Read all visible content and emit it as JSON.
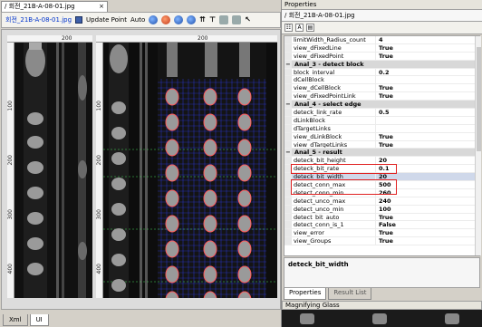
{
  "document": {
    "tab_title": "/ 회전_21B-A-08-01.jpg",
    "close_glyph": "×",
    "file_label": "회전_21B-A-08-01.jpg",
    "update_point": "Update Point",
    "auto": "Auto",
    "ruler_left_panel_top": "200",
    "ruler_right_panel_top": "200",
    "left_ruler_marks": [
      "100",
      "200",
      "300",
      "400"
    ],
    "right_ruler_marks": [
      "100",
      "200",
      "300",
      "400"
    ],
    "bottom_tabs": [
      "Xml",
      "UI"
    ]
  },
  "properties": {
    "title": "Properties",
    "subtitle": "/ 회전_21B-A-08-01.jpg",
    "rows": [
      {
        "name": "limitWidth_Radius_count",
        "value": "4",
        "type": "prop"
      },
      {
        "name": "view_dFixedLine",
        "value": "True",
        "type": "prop"
      },
      {
        "name": "view_dFixedPoint",
        "value": "True",
        "type": "prop"
      },
      {
        "name": "Anal_3 - detect block",
        "value": "",
        "type": "cat"
      },
      {
        "name": "block_interval",
        "value": "0.2",
        "type": "prop"
      },
      {
        "name": "dCellBlock",
        "value": "",
        "type": "prop"
      },
      {
        "name": "view_dCellBlock",
        "value": "True",
        "type": "prop"
      },
      {
        "name": "view_dFixedPointLink",
        "value": "True",
        "type": "prop"
      },
      {
        "name": "Anal_4 - select edge",
        "value": "",
        "type": "cat"
      },
      {
        "name": "deteck_link_rate",
        "value": "0.5",
        "type": "prop"
      },
      {
        "name": "dLinkBlock",
        "value": "",
        "type": "prop"
      },
      {
        "name": "dTargetLinks",
        "value": "",
        "type": "prop"
      },
      {
        "name": "view_dLinkBlock",
        "value": "True",
        "type": "prop"
      },
      {
        "name": "view_dTargetLinks",
        "value": "True",
        "type": "prop"
      },
      {
        "name": "Anal_5 - result",
        "value": "",
        "type": "cat"
      },
      {
        "name": "deteck_bit_height",
        "value": "20",
        "type": "prop"
      },
      {
        "name": "deteck_bit_rate",
        "value": "0.1",
        "type": "prop"
      },
      {
        "name": "deteck_bit_width",
        "value": "20",
        "type": "sel"
      },
      {
        "name": "detect_conn_max",
        "value": "500",
        "type": "prop"
      },
      {
        "name": "detect_conn_min",
        "value": "260",
        "type": "prop"
      },
      {
        "name": "detect_unco_max",
        "value": "240",
        "type": "prop"
      },
      {
        "name": "detect_unco_min",
        "value": "100",
        "type": "prop"
      },
      {
        "name": "detect_bit_auto",
        "value": "True",
        "type": "prop"
      },
      {
        "name": "detect_conn_is_1",
        "value": "False",
        "type": "prop"
      },
      {
        "name": "view_error",
        "value": "True",
        "type": "prop"
      },
      {
        "name": "view_Groups",
        "value": "True",
        "type": "prop"
      }
    ],
    "description": "deteck_bit_width",
    "tabs": [
      "Properties",
      "Result List"
    ],
    "magnifier_title": "Magnifying Glass"
  },
  "colors": {
    "highlight": "#e02020",
    "grid_line": "#2a37d6",
    "marker": "#ff5a5a",
    "guide": "#46d85a"
  }
}
